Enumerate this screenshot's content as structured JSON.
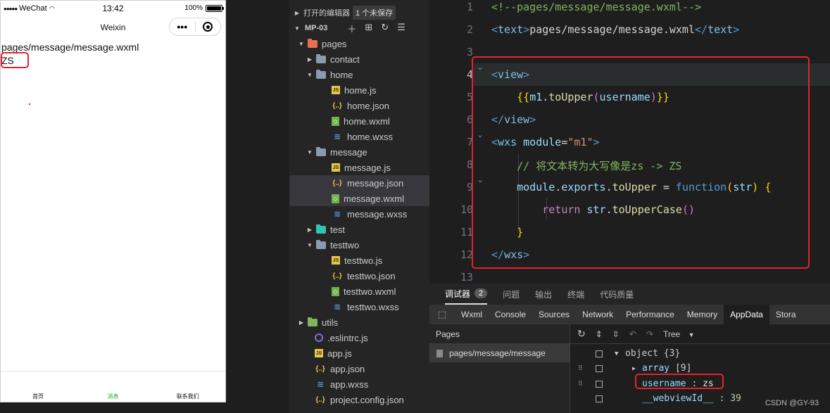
{
  "phone": {
    "carrier": "WeChat",
    "signal_dots": "●●●●●",
    "time": "13:42",
    "battery_text": "100%",
    "battery_level": 1.0,
    "nav_title": "Weixin",
    "page_path": "pages/message/message.wxml",
    "output_text": "ZS",
    "tabs": [
      "首页",
      "消息",
      "联系我们"
    ],
    "active_tab_index": 1
  },
  "explorer": {
    "open_editors_label": "打开的编辑器",
    "unsaved_badge": "1 个未保存",
    "project_name": "MP-03",
    "tree": [
      {
        "label": "pages",
        "icon": "folder-red-icon",
        "depth": 0,
        "caret": "open"
      },
      {
        "label": "contact",
        "icon": "folder-icon",
        "depth": 1,
        "caret": "closed"
      },
      {
        "label": "home",
        "icon": "folder-icon",
        "depth": 1,
        "caret": "open"
      },
      {
        "label": "home.js",
        "icon": "js-icon",
        "depth": 2
      },
      {
        "label": "home.json",
        "icon": "json-icon",
        "depth": 2
      },
      {
        "label": "home.wxml",
        "icon": "wxml-icon",
        "depth": 2
      },
      {
        "label": "home.wxss",
        "icon": "wxss-icon",
        "depth": 2
      },
      {
        "label": "message",
        "icon": "folder-icon",
        "depth": 1,
        "caret": "open"
      },
      {
        "label": "message.js",
        "icon": "js-icon",
        "depth": 2
      },
      {
        "label": "message.json",
        "icon": "json-icon",
        "depth": 2,
        "selected": true
      },
      {
        "label": "message.wxml",
        "icon": "wxml-icon",
        "depth": 2,
        "selected": true
      },
      {
        "label": "message.wxss",
        "icon": "wxss-icon",
        "depth": 2
      },
      {
        "label": "test",
        "icon": "folder-teal-icon",
        "depth": 1,
        "caret": "closed"
      },
      {
        "label": "testtwo",
        "icon": "folder-icon",
        "depth": 1,
        "caret": "open"
      },
      {
        "label": "testtwo.js",
        "icon": "js-icon",
        "depth": 2
      },
      {
        "label": "testtwo.json",
        "icon": "json-icon",
        "depth": 2
      },
      {
        "label": "testtwo.wxml",
        "icon": "wxml-icon",
        "depth": 2
      },
      {
        "label": "testtwo.wxss",
        "icon": "wxss-icon",
        "depth": 2
      },
      {
        "label": "utils",
        "icon": "folder-green-icon",
        "depth": 0,
        "caret": "closed"
      },
      {
        "label": ".eslintrc.js",
        "icon": "eslint-icon",
        "depth": 0
      },
      {
        "label": "app.js",
        "icon": "js-icon",
        "depth": 0
      },
      {
        "label": "app.json",
        "icon": "json-icon",
        "depth": 0
      },
      {
        "label": "app.wxss",
        "icon": "wxss-icon",
        "depth": 0
      },
      {
        "label": "project.config.json",
        "icon": "json-icon",
        "depth": 0
      }
    ]
  },
  "editor": {
    "line_numbers": [
      "1",
      "2",
      "3",
      "4",
      "5",
      "6",
      "7",
      "8",
      "9",
      "10",
      "11",
      "12",
      "13"
    ],
    "current_line": "4",
    "lines": [
      "<!--pages/message/message.wxml-->",
      "<text>pages/message/message.wxml</text>",
      "",
      "<view>",
      "    {{m1.toUpper(username)}}",
      "</view>",
      "<wxs module=\"m1\">",
      "    // 将文本转为大写像是zs -> ZS",
      "    module.exports.toUpper = function(str) {",
      "        return str.toUpperCase()",
      "    }",
      "</wxs>",
      ""
    ]
  },
  "devtools": {
    "top_tabs": [
      "调试器",
      "问题",
      "输出",
      "终端",
      "代码质量"
    ],
    "debugger_count": "2",
    "panel_tabs": [
      "Wxml",
      "Console",
      "Sources",
      "Network",
      "Performance",
      "Memory",
      "AppData",
      "Stora"
    ],
    "active_panel_tab": "AppData",
    "pages_header": "Pages",
    "page_entry": "pages/message/message",
    "view_mode": "Tree",
    "tree": {
      "root": "object",
      "root_count": "{3}",
      "array_label": "array",
      "array_count": "[9]",
      "username_key": "username",
      "username_value": "zs",
      "webview_key": "__webviewId__",
      "webview_value": "39"
    }
  },
  "watermark": "CSDN @GY-93"
}
